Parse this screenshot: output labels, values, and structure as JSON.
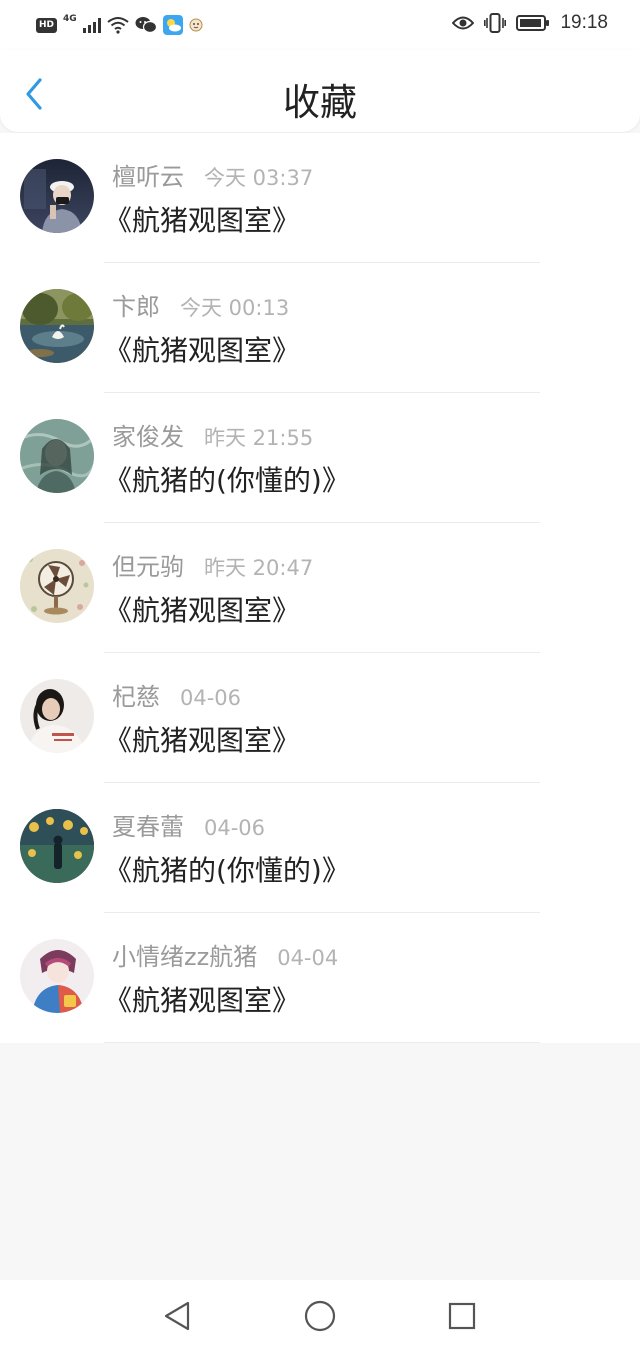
{
  "status_bar": {
    "hd": "HD",
    "network": "4G",
    "time": "19:18"
  },
  "header": {
    "title": "收藏",
    "back_icon": "chevron-left-icon"
  },
  "favorites": [
    {
      "name": "檀听云",
      "time": "今天 03:37",
      "title": "《航猪观图室》",
      "avatar": "avatar-1"
    },
    {
      "name": "卞郎",
      "time": "今天 00:13",
      "title": "《航猪观图室》",
      "avatar": "avatar-2"
    },
    {
      "name": "家俊发",
      "time": "昨天 21:55",
      "title": "《航猪的(你懂的)》",
      "avatar": "avatar-3"
    },
    {
      "name": "但元驹",
      "time": "昨天 20:47",
      "title": "《航猪观图室》",
      "avatar": "avatar-4"
    },
    {
      "name": "杞慈",
      "time": "04-06",
      "title": "《航猪观图室》",
      "avatar": "avatar-5"
    },
    {
      "name": "夏春蕾",
      "time": "04-06",
      "title": "《航猪的(你懂的)》",
      "avatar": "avatar-6"
    },
    {
      "name": "小情绪zz航猪",
      "time": "04-04",
      "title": "《航猪观图室》",
      "avatar": "avatar-7"
    }
  ],
  "nav_bar": {
    "back_icon": "triangle-back-icon",
    "home_icon": "circle-home-icon",
    "recents_icon": "square-recents-icon"
  },
  "colors": {
    "accent": "#2f9ae0",
    "name_text": "#9a9a9a",
    "time_text": "#b3b3b3",
    "title_text": "#222222",
    "background": "#f8f7f8"
  }
}
